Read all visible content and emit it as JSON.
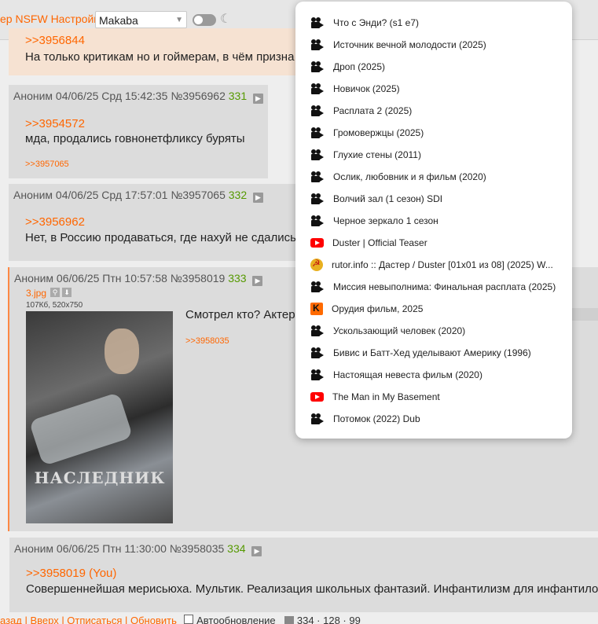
{
  "topbar": {
    "links": "ер NSFW Настройки",
    "style_select": "Makaba"
  },
  "posts": [
    {
      "ref": ">>3956844",
      "text": "На только критикам но и гоймерам, в чём призна"
    },
    {
      "header": "Аноним 04/06/25 Срд 15:42:35 №3956962",
      "num": "331",
      "ref": ">>3954572",
      "text": "мда, продались говнонетфликсу буряты",
      "reply": ">>3957065"
    },
    {
      "header": "Аноним 04/06/25 Срд 17:57:01 №3957065",
      "num": "332",
      "ref": ">>3956962",
      "text": "Нет, в Россию продаваться, где нахуй не сдались"
    },
    {
      "header": "Аноним 06/06/25 Птн 10:57:58 №3958019",
      "num": "333",
      "file_name": "3.jpg",
      "file_meta": "107Кб, 520x750",
      "poster_title": "НАСЛЕДНИК",
      "text": "Смотрел кто? Актеры",
      "reply": ">>3958035"
    },
    {
      "header": "Аноним 06/06/25 Птн 11:30:00 №3958035",
      "num": "334",
      "ref": ">>3958019 (You)",
      "text": "Совершеннейшая мерисьюха. Мультик. Реализация школьных фантазий. Инфантилизм для инфантилов"
    }
  ],
  "history": [
    {
      "icon": "movie-camera-icon",
      "label": "Что с Энди? (s1 e7)"
    },
    {
      "icon": "movie-camera-icon",
      "label": "Источник вечной молодости (2025)"
    },
    {
      "icon": "movie-camera-icon",
      "label": "Дроп (2025)"
    },
    {
      "icon": "movie-camera-icon",
      "label": "Новичок (2025)"
    },
    {
      "icon": "movie-camera-icon",
      "label": "Расплата 2 (2025)"
    },
    {
      "icon": "movie-camera-icon",
      "label": "Громовержцы (2025)"
    },
    {
      "icon": "movie-camera-icon",
      "label": "Глухие стены (2011)"
    },
    {
      "icon": "movie-camera-icon",
      "label": "Ослик, любовник и я фильм (2020)"
    },
    {
      "icon": "movie-camera-icon",
      "label": "Волчий зал (1 сезон) SDI"
    },
    {
      "icon": "movie-camera-icon",
      "label": "Черное зеркало 1 сезон"
    },
    {
      "icon": "youtube-icon",
      "label": "Duster | Official Teaser"
    },
    {
      "icon": "rutor-icon",
      "label": "rutor.info :: Дастер / Duster [01x01 из 08] (2025) W..."
    },
    {
      "icon": "movie-camera-icon",
      "label": "Миссия невыполнима: Финальная расплата (2025)"
    },
    {
      "icon": "kinopoisk-icon",
      "label": "Орудия фильм, 2025"
    },
    {
      "icon": "movie-camera-icon",
      "label": "Ускользающий человек (2020)"
    },
    {
      "icon": "movie-camera-icon",
      "label": "Бивис и Батт-Хед уделывают Америку (1996)"
    },
    {
      "icon": "movie-camera-icon",
      "label": "Настоящая невеста фильм (2020)"
    },
    {
      "icon": "youtube-icon",
      "label": "The Man in My Basement"
    },
    {
      "icon": "movie-camera-icon",
      "label": "Потомок (2022) Dub"
    }
  ],
  "footer": {
    "links": "азад | Вверх | Отписаться | Обновить",
    "autoupdate": "Автообновление",
    "stats": "334 · 128 · 99"
  }
}
